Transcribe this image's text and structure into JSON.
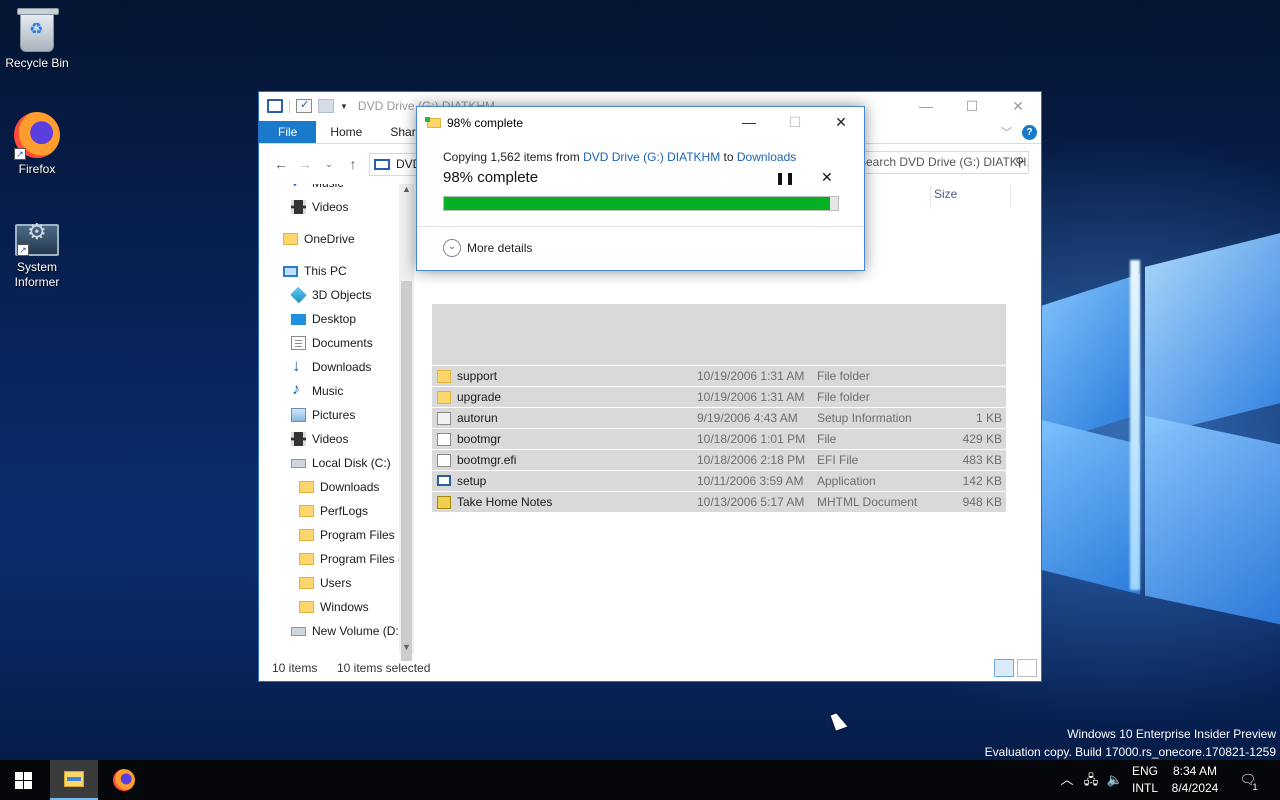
{
  "desktop": {
    "icons": [
      {
        "label": "Recycle Bin",
        "icon": "recycle-bin-icon"
      },
      {
        "label": "Firefox",
        "icon": "firefox-icon"
      },
      {
        "label": "System Informer",
        "icon": "system-informer-icon"
      }
    ],
    "watermark": {
      "line1": "Windows 10 Enterprise Insider Preview",
      "line2": "Evaluation copy. Build 17000.rs_onecore.170821-1259"
    }
  },
  "explorer": {
    "title": "DVD Drive (G:) DIATKHM",
    "tabs": [
      "File",
      "Home",
      "Share"
    ],
    "address_text": "DVD",
    "search_placeholder": "Search DVD Drive (G:) DIATKH...",
    "columns": {
      "size": "Size"
    },
    "nav_items": [
      {
        "label": "Music",
        "icon": "music-icon",
        "indent": 1
      },
      {
        "label": "Videos",
        "icon": "videos-icon",
        "indent": 1
      },
      {
        "label": "OneDrive",
        "icon": "onedrive-icon",
        "indent": 0
      },
      {
        "label": "This PC",
        "icon": "this-pc-icon",
        "indent": 0
      },
      {
        "label": "3D Objects",
        "icon": "3d-objects-icon",
        "indent": 1
      },
      {
        "label": "Desktop",
        "icon": "desktop-icon",
        "indent": 1
      },
      {
        "label": "Documents",
        "icon": "documents-icon",
        "indent": 1
      },
      {
        "label": "Downloads",
        "icon": "downloads-icon",
        "indent": 1
      },
      {
        "label": "Music",
        "icon": "music-icon",
        "indent": 1
      },
      {
        "label": "Pictures",
        "icon": "pictures-icon",
        "indent": 1
      },
      {
        "label": "Videos",
        "icon": "videos-icon",
        "indent": 1
      },
      {
        "label": "Local Disk (C:)",
        "icon": "local-disk-icon",
        "indent": 1
      },
      {
        "label": "Downloads",
        "icon": "folder-icon",
        "indent": 2
      },
      {
        "label": "PerfLogs",
        "icon": "folder-icon",
        "indent": 2
      },
      {
        "label": "Program Files",
        "icon": "folder-icon",
        "indent": 2
      },
      {
        "label": "Program Files (",
        "icon": "folder-icon",
        "indent": 2
      },
      {
        "label": "Users",
        "icon": "folder-icon",
        "indent": 2
      },
      {
        "label": "Windows",
        "icon": "folder-icon",
        "indent": 2
      },
      {
        "label": "New Volume (D:",
        "icon": "drive-icon",
        "indent": 1
      }
    ],
    "files": [
      {
        "name": "support",
        "date": "10/19/2006 1:31 AM",
        "type": "File folder",
        "size": "",
        "icon": "folder"
      },
      {
        "name": "upgrade",
        "date": "10/19/2006 1:31 AM",
        "type": "File folder",
        "size": "",
        "icon": "folder"
      },
      {
        "name": "autorun",
        "date": "9/19/2006 4:43 AM",
        "type": "Setup Information",
        "size": "1 KB",
        "icon": "inf"
      },
      {
        "name": "bootmgr",
        "date": "10/18/2006 1:01 PM",
        "type": "File",
        "size": "429 KB",
        "icon": "file"
      },
      {
        "name": "bootmgr.efi",
        "date": "10/18/2006 2:18 PM",
        "type": "EFI File",
        "size": "483 KB",
        "icon": "file"
      },
      {
        "name": "setup",
        "date": "10/11/2006 3:59 AM",
        "type": "Application",
        "size": "142 KB",
        "icon": "setup"
      },
      {
        "name": "Take Home Notes",
        "date": "10/13/2006 5:17 AM",
        "type": "MHTML Document",
        "size": "948 KB",
        "icon": "mht"
      }
    ],
    "status": {
      "count": "10 items",
      "selected": "10 items selected"
    }
  },
  "copy_dialog": {
    "title": "98% complete",
    "copying_prefix": "Copying 1,562 items from",
    "source": "DVD Drive (G:) DIATKHM",
    "to_word": "to",
    "destination": "Downloads",
    "percent_label": "98% complete",
    "progress": 0.98,
    "more_details": "More details",
    "progress_color": "#06b025"
  },
  "taskbar": {
    "lang_top": "ENG",
    "lang_bottom": "INTL",
    "time": "8:34 AM",
    "date": "8/4/2024",
    "notifications": "1"
  }
}
